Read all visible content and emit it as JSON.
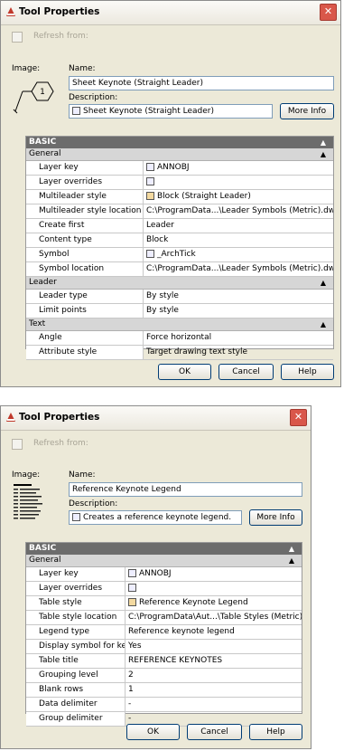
{
  "dialog1": {
    "title": "Tool Properties",
    "refresh_label": "Refresh from:",
    "image_label": "Image:",
    "image_symbol": "1",
    "name_label": "Name:",
    "name_value": "Sheet Keynote (Straight Leader)",
    "desc_label": "Description:",
    "desc_value": "Sheet Keynote (Straight Leader)",
    "more_info": "More Info",
    "grid_title": "BASIC",
    "categories": [
      {
        "name": "General",
        "rows": [
          {
            "key": "Layer key",
            "value": "ANNOBJ"
          },
          {
            "key": "Layer overrides",
            "value": ""
          },
          {
            "key": "Multileader style",
            "value": "Block (Straight Leader)"
          },
          {
            "key": "Multileader style location",
            "value": "C:\\ProgramData...\\Leader Symbols (Metric).dwg"
          },
          {
            "key": "Create first",
            "value": "Leader"
          },
          {
            "key": "Content type",
            "value": "Block"
          },
          {
            "key": "Symbol",
            "value": "_ArchTick"
          },
          {
            "key": "Symbol location",
            "value": "C:\\ProgramData...\\Leader Symbols (Metric).dwg"
          }
        ]
      },
      {
        "name": "Leader",
        "rows": [
          {
            "key": "Leader type",
            "value": "By style"
          },
          {
            "key": "Limit points",
            "value": "By style"
          }
        ]
      },
      {
        "name": "Text",
        "rows": [
          {
            "key": "Angle",
            "value": "Force horizontal"
          },
          {
            "key": "Attribute style",
            "value": "Target drawing text style"
          }
        ]
      }
    ],
    "ok": "OK",
    "cancel": "Cancel",
    "help": "Help"
  },
  "dialog2": {
    "title": "Tool Properties",
    "refresh_label": "Refresh from:",
    "image_label": "Image:",
    "name_label": "Name:",
    "name_value": "Reference Keynote Legend",
    "desc_label": "Description:",
    "desc_value": "Creates a reference keynote legend.",
    "more_info": "More Info",
    "grid_title": "BASIC",
    "categories": [
      {
        "name": "General",
        "rows": [
          {
            "key": "Layer key",
            "value": "ANNOBJ"
          },
          {
            "key": "Layer overrides",
            "value": ""
          },
          {
            "key": "Table style",
            "value": "Reference Keynote Legend"
          },
          {
            "key": "Table style location",
            "value": "C:\\ProgramData\\Aut...\\Table Styles (Metric).dwg"
          },
          {
            "key": "Legend type",
            "value": "Reference keynote legend"
          },
          {
            "key": "Display symbol for key",
            "value": "Yes"
          },
          {
            "key": "Table title",
            "value": "REFERENCE KEYNOTES"
          },
          {
            "key": "Grouping level",
            "value": "2"
          },
          {
            "key": "Blank rows",
            "value": "1"
          },
          {
            "key": "Data delimiter",
            "value": "-"
          },
          {
            "key": "Group delimiter",
            "value": "-"
          }
        ]
      }
    ],
    "ok": "OK",
    "cancel": "Cancel",
    "help": "Help"
  }
}
